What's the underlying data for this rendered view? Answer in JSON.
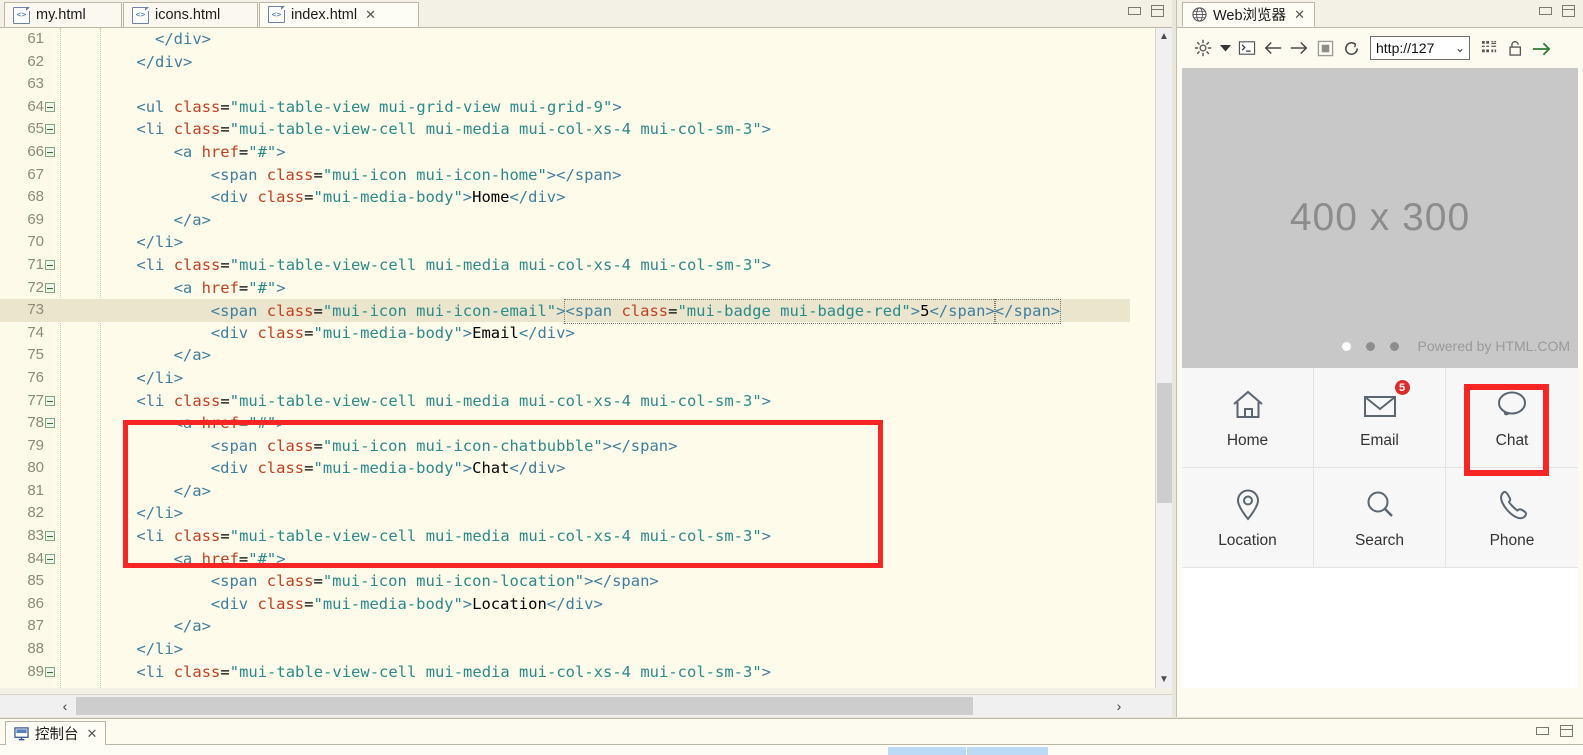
{
  "editor": {
    "tabs": [
      {
        "label": "my.html",
        "active": false,
        "closable": false,
        "icon": "html-file-icon"
      },
      {
        "label": "icons.html",
        "active": false,
        "closable": false,
        "icon": "html-file-icon"
      },
      {
        "label": "index.html",
        "active": true,
        "closable": true,
        "icon": "html-file-icon"
      }
    ],
    "window_controls": {
      "minimize": "minimize-icon",
      "maximize": "maximize-icon"
    },
    "lines": [
      {
        "n": "61",
        "fold": false,
        "hl": false,
        "indent": 10,
        "parts": [
          {
            "t": "tg",
            "v": "</div>"
          }
        ]
      },
      {
        "n": "62",
        "fold": false,
        "hl": false,
        "indent": 8,
        "parts": [
          {
            "t": "tg",
            "v": "</div>"
          }
        ]
      },
      {
        "n": "63",
        "fold": false,
        "hl": false,
        "indent": 0,
        "parts": []
      },
      {
        "n": "64",
        "fold": true,
        "hl": false,
        "indent": 8,
        "parts": [
          {
            "t": "tg",
            "v": "<ul "
          },
          {
            "t": "at",
            "v": "class"
          },
          {
            "t": "eq",
            "v": "="
          },
          {
            "t": "st",
            "v": "\"mui-table-view mui-grid-view mui-grid-9\""
          },
          {
            "t": "tg",
            "v": ">"
          }
        ]
      },
      {
        "n": "65",
        "fold": true,
        "hl": false,
        "indent": 8,
        "parts": [
          {
            "t": "tg",
            "v": "<li "
          },
          {
            "t": "at",
            "v": "class"
          },
          {
            "t": "eq",
            "v": "="
          },
          {
            "t": "st",
            "v": "\"mui-table-view-cell mui-media mui-col-xs-4 mui-col-sm-3\""
          },
          {
            "t": "tg",
            "v": ">"
          }
        ]
      },
      {
        "n": "66",
        "fold": true,
        "hl": false,
        "indent": 12,
        "parts": [
          {
            "t": "tg",
            "v": "<a "
          },
          {
            "t": "at",
            "v": "href"
          },
          {
            "t": "eq",
            "v": "="
          },
          {
            "t": "st",
            "v": "\"#\""
          },
          {
            "t": "tg",
            "v": ">"
          }
        ]
      },
      {
        "n": "67",
        "fold": false,
        "hl": false,
        "indent": 16,
        "parts": [
          {
            "t": "tg",
            "v": "<span "
          },
          {
            "t": "at",
            "v": "class"
          },
          {
            "t": "eq",
            "v": "="
          },
          {
            "t": "st",
            "v": "\"mui-icon mui-icon-home\""
          },
          {
            "t": "tg",
            "v": "></span>"
          }
        ]
      },
      {
        "n": "68",
        "fold": false,
        "hl": false,
        "indent": 16,
        "parts": [
          {
            "t": "tg",
            "v": "<div "
          },
          {
            "t": "at",
            "v": "class"
          },
          {
            "t": "eq",
            "v": "="
          },
          {
            "t": "st",
            "v": "\"mui-media-body\""
          },
          {
            "t": "tg",
            "v": ">"
          },
          {
            "t": "pt",
            "v": "Home"
          },
          {
            "t": "tg",
            "v": "</div>"
          }
        ]
      },
      {
        "n": "69",
        "fold": false,
        "hl": false,
        "indent": 12,
        "parts": [
          {
            "t": "tg",
            "v": "</a>"
          }
        ]
      },
      {
        "n": "70",
        "fold": false,
        "hl": false,
        "indent": 8,
        "parts": [
          {
            "t": "tg",
            "v": "</li>"
          }
        ]
      },
      {
        "n": "71",
        "fold": true,
        "hl": false,
        "indent": 8,
        "parts": [
          {
            "t": "tg",
            "v": "<li "
          },
          {
            "t": "at",
            "v": "class"
          },
          {
            "t": "eq",
            "v": "="
          },
          {
            "t": "st",
            "v": "\"mui-table-view-cell mui-media mui-col-xs-4 mui-col-sm-3\""
          },
          {
            "t": "tg",
            "v": ">"
          }
        ]
      },
      {
        "n": "72",
        "fold": true,
        "hl": false,
        "indent": 12,
        "parts": [
          {
            "t": "tg",
            "v": "<a "
          },
          {
            "t": "at",
            "v": "href"
          },
          {
            "t": "eq",
            "v": "="
          },
          {
            "t": "st",
            "v": "\"#\""
          },
          {
            "t": "tg",
            "v": ">"
          }
        ]
      },
      {
        "n": "73",
        "fold": false,
        "hl": true,
        "indent": 16,
        "parts": [
          {
            "t": "tg",
            "v": "<span "
          },
          {
            "t": "at",
            "v": "class"
          },
          {
            "t": "eq",
            "v": "="
          },
          {
            "t": "st",
            "v": "\"mui-icon mui-icon-email\""
          },
          {
            "t": "tg",
            "v": ">"
          },
          {
            "t": "sel",
            "v": "SELSTART"
          },
          {
            "t": "tg",
            "v": "<span "
          },
          {
            "t": "at",
            "v": "class"
          },
          {
            "t": "eq",
            "v": "="
          },
          {
            "t": "st",
            "v": "\"mui-badge mui-badge-red\""
          },
          {
            "t": "tg",
            "v": ">"
          },
          {
            "t": "pt",
            "v": "5"
          },
          {
            "t": "sel2",
            "v": "</span>"
          },
          {
            "t": "tg",
            "v": "</span>"
          }
        ]
      },
      {
        "n": "74",
        "fold": false,
        "hl": false,
        "indent": 16,
        "parts": [
          {
            "t": "tg",
            "v": "<div "
          },
          {
            "t": "at",
            "v": "class"
          },
          {
            "t": "eq",
            "v": "="
          },
          {
            "t": "st",
            "v": "\"mui-media-body\""
          },
          {
            "t": "tg",
            "v": ">"
          },
          {
            "t": "pt",
            "v": "Email"
          },
          {
            "t": "tg",
            "v": "</div>"
          }
        ]
      },
      {
        "n": "75",
        "fold": false,
        "hl": false,
        "indent": 12,
        "parts": [
          {
            "t": "tg",
            "v": "</a>"
          }
        ]
      },
      {
        "n": "76",
        "fold": false,
        "hl": false,
        "indent": 8,
        "parts": [
          {
            "t": "tg",
            "v": "</li>"
          }
        ]
      },
      {
        "n": "77",
        "fold": true,
        "hl": false,
        "indent": 8,
        "parts": [
          {
            "t": "tg",
            "v": "<li "
          },
          {
            "t": "at",
            "v": "class"
          },
          {
            "t": "eq",
            "v": "="
          },
          {
            "t": "st",
            "v": "\"mui-table-view-cell mui-media mui-col-xs-4 mui-col-sm-3\""
          },
          {
            "t": "tg",
            "v": ">"
          }
        ]
      },
      {
        "n": "78",
        "fold": true,
        "hl": false,
        "indent": 12,
        "parts": [
          {
            "t": "tg",
            "v": "<a "
          },
          {
            "t": "at",
            "v": "href"
          },
          {
            "t": "eq",
            "v": "="
          },
          {
            "t": "st",
            "v": "\"#\""
          },
          {
            "t": "tg",
            "v": ">"
          }
        ]
      },
      {
        "n": "79",
        "fold": false,
        "hl": false,
        "indent": 16,
        "parts": [
          {
            "t": "tg",
            "v": "<span "
          },
          {
            "t": "at",
            "v": "class"
          },
          {
            "t": "eq",
            "v": "="
          },
          {
            "t": "st",
            "v": "\"mui-icon mui-icon-chatbubble\""
          },
          {
            "t": "tg",
            "v": "></span>"
          }
        ]
      },
      {
        "n": "80",
        "fold": false,
        "hl": false,
        "indent": 16,
        "parts": [
          {
            "t": "tg",
            "v": "<div "
          },
          {
            "t": "at",
            "v": "class"
          },
          {
            "t": "eq",
            "v": "="
          },
          {
            "t": "st",
            "v": "\"mui-media-body\""
          },
          {
            "t": "tg",
            "v": ">"
          },
          {
            "t": "pt",
            "v": "Chat"
          },
          {
            "t": "tg",
            "v": "</div>"
          }
        ]
      },
      {
        "n": "81",
        "fold": false,
        "hl": false,
        "indent": 12,
        "parts": [
          {
            "t": "tg",
            "v": "</a>"
          }
        ]
      },
      {
        "n": "82",
        "fold": false,
        "hl": false,
        "indent": 8,
        "parts": [
          {
            "t": "tg",
            "v": "</li>"
          }
        ]
      },
      {
        "n": "83",
        "fold": true,
        "hl": false,
        "indent": 8,
        "parts": [
          {
            "t": "tg",
            "v": "<li "
          },
          {
            "t": "at",
            "v": "class"
          },
          {
            "t": "eq",
            "v": "="
          },
          {
            "t": "st",
            "v": "\"mui-table-view-cell mui-media mui-col-xs-4 mui-col-sm-3\""
          },
          {
            "t": "tg",
            "v": ">"
          }
        ]
      },
      {
        "n": "84",
        "fold": true,
        "hl": false,
        "indent": 12,
        "parts": [
          {
            "t": "tg",
            "v": "<a "
          },
          {
            "t": "at",
            "v": "href"
          },
          {
            "t": "eq",
            "v": "="
          },
          {
            "t": "st",
            "v": "\"#\""
          },
          {
            "t": "tg",
            "v": ">"
          }
        ]
      },
      {
        "n": "85",
        "fold": false,
        "hl": false,
        "indent": 16,
        "parts": [
          {
            "t": "tg",
            "v": "<span "
          },
          {
            "t": "at",
            "v": "class"
          },
          {
            "t": "eq",
            "v": "="
          },
          {
            "t": "st",
            "v": "\"mui-icon mui-icon-location\""
          },
          {
            "t": "tg",
            "v": "></span>"
          }
        ]
      },
      {
        "n": "86",
        "fold": false,
        "hl": false,
        "indent": 16,
        "parts": [
          {
            "t": "tg",
            "v": "<div "
          },
          {
            "t": "at",
            "v": "class"
          },
          {
            "t": "eq",
            "v": "="
          },
          {
            "t": "st",
            "v": "\"mui-media-body\""
          },
          {
            "t": "tg",
            "v": ">"
          },
          {
            "t": "pt",
            "v": "Location"
          },
          {
            "t": "tg",
            "v": "</div>"
          }
        ]
      },
      {
        "n": "87",
        "fold": false,
        "hl": false,
        "indent": 12,
        "parts": [
          {
            "t": "tg",
            "v": "</a>"
          }
        ]
      },
      {
        "n": "88",
        "fold": false,
        "hl": false,
        "indent": 8,
        "parts": [
          {
            "t": "tg",
            "v": "</li>"
          }
        ]
      },
      {
        "n": "89",
        "fold": true,
        "hl": false,
        "indent": 8,
        "parts": [
          {
            "t": "tg",
            "v": "<li "
          },
          {
            "t": "at",
            "v": "class"
          },
          {
            "t": "eq",
            "v": "="
          },
          {
            "t": "st",
            "v": "\"mui-table-view-cell mui-media mui-col-xs-4 mui-col-sm-3\""
          },
          {
            "t": "tg",
            "v": ">"
          }
        ]
      }
    ],
    "annotation_box_color": "#f82525"
  },
  "browser": {
    "tab_label": "Web浏览器",
    "tab_icon": "globe-icon",
    "tab_close": "✕",
    "toolbar": [
      {
        "name": "settings-gear-icon"
      },
      {
        "name": "dropdown-arrow-icon"
      },
      {
        "name": "console-terminal-icon"
      },
      {
        "name": "back-arrow-icon"
      },
      {
        "name": "forward-arrow-icon"
      },
      {
        "name": "stop-icon"
      },
      {
        "name": "refresh-icon"
      }
    ],
    "toolbar_right": [
      {
        "name": "qr-code-icon"
      },
      {
        "name": "unlock-padlock-icon"
      },
      {
        "name": "go-arrow-icon"
      }
    ],
    "url_value": "http://127",
    "url_dropdown": "⌄",
    "preview": {
      "placeholder_label": "400 x 300",
      "powered_by": "Powered by HTML.COM",
      "carousel_dots": 3,
      "carousel_active_index": 0,
      "grid": [
        {
          "label": "Home",
          "icon": "home-icon",
          "badge": null,
          "highlighted": false
        },
        {
          "label": "Email",
          "icon": "email-icon",
          "badge": "5",
          "highlighted": false
        },
        {
          "label": "Chat",
          "icon": "chatbubble-icon",
          "badge": null,
          "highlighted": true
        },
        {
          "label": "Location",
          "icon": "location-icon",
          "badge": null,
          "highlighted": false
        },
        {
          "label": "Search",
          "icon": "search-icon",
          "badge": null,
          "highlighted": false
        },
        {
          "label": "Phone",
          "icon": "phone-icon",
          "badge": null,
          "highlighted": false
        }
      ],
      "badge_color": "#dd2c2c"
    }
  },
  "console": {
    "tab_label": "控制台",
    "tab_icon": "console-monitor-icon",
    "tab_close": "✕",
    "window_controls": {
      "minimize": "minimize-icon",
      "maximize": "maximize-icon"
    }
  }
}
